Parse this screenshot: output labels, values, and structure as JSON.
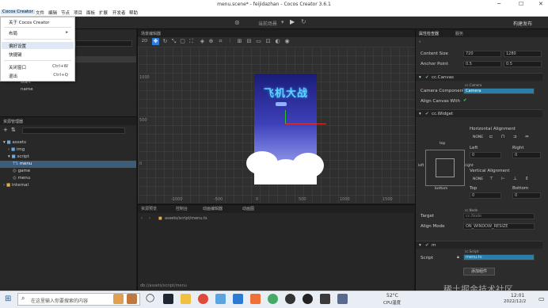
{
  "window": {
    "title": "menu.scene* - feijidazhan - Cocos Creator 3.6.1"
  },
  "menubar": {
    "items": [
      "Cocos Creator",
      "文件",
      "编辑",
      "节点",
      "项目",
      "面板",
      "扩展",
      "开发者",
      "帮助"
    ]
  },
  "dropdown": {
    "items": [
      {
        "label": "关于 Cocos Creator",
        "shortcut": ""
      },
      {
        "label": "布局",
        "shortcut": "▸"
      },
      {
        "label": "偏好设置",
        "shortcut": ""
      },
      {
        "label": "快捷键",
        "shortcut": ""
      },
      {
        "label": "关闭窗口",
        "shortcut": "Ctrl+W"
      },
      {
        "label": "退出",
        "shortcut": "Ctrl+Q"
      }
    ]
  },
  "toolbar": {
    "current_scene": "当前场景",
    "build_release": "构建发布"
  },
  "hierarchy": {
    "nodes": [
      "start",
      "name"
    ]
  },
  "assets": {
    "title": "资源管理器",
    "tree": [
      "assets",
      "img",
      "script",
      "menu",
      "game",
      "menu",
      "internal"
    ]
  },
  "scene": {
    "title": "场景编辑器",
    "toolbar_label": "2D",
    "ruler_left": [
      "1000",
      "500",
      "0"
    ],
    "ruler_bottom": [
      "-1000",
      "-500",
      "0",
      "500",
      "1000",
      "1500"
    ],
    "game_title": "飞机大战"
  },
  "console": {
    "tabs": [
      "资源预览",
      "控制台",
      "动画编辑器",
      "动画图"
    ],
    "path": "assets/script/menu.ts",
    "footer_path": "db://assets/script/menu"
  },
  "inspector": {
    "tabs": [
      "属性检查器",
      "服务"
    ],
    "content_size": {
      "label": "Content Size",
      "w": "720",
      "h": "1280"
    },
    "anchor_point": {
      "label": "Anchor Point",
      "x": "0.5",
      "y": "0.5"
    },
    "canvas": {
      "title": "cc.Canvas",
      "camera_label": "Camera Component",
      "camera_tag": "cc.Camera",
      "camera_value": "Camera",
      "align_label": "Align Canvas With"
    },
    "widget": {
      "title": "cc.Widget",
      "halign": "Horizontal Alignment",
      "none": "NONE",
      "left": "Left",
      "right": "Right",
      "left_val": "0",
      "right_val": "0",
      "valign": "Vertical Alignment",
      "top": "Top",
      "bottom": "Bottom",
      "top_val": "0",
      "bottom_val": "0",
      "top_lbl": "top",
      "bottom_lbl": "bottom",
      "left_lbl": "left",
      "right_lbl": "right",
      "target_label": "Target",
      "target_tag": "cc.Node",
      "target_placeholder": "cc.Node",
      "align_mode_label": "Align Mode",
      "align_mode": "ON_WINDOW_RESIZE"
    },
    "script": {
      "title": "m",
      "label": "Script",
      "tag": "cc.Script",
      "value": "menu.ts",
      "add_component": "添加组件"
    }
  },
  "taskbar": {
    "search_placeholder": "在这里输入你要搜索的内容",
    "temperature": "52°C",
    "cpu": "CPU温度",
    "time": "12:01",
    "date": "2022/12/2",
    "watermark": "稀土掘金技术社区"
  }
}
